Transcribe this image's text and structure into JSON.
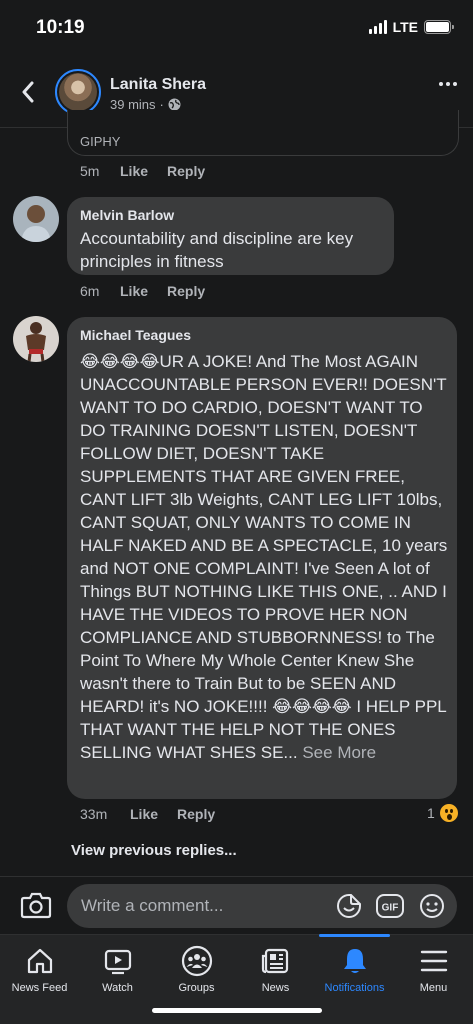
{
  "status": {
    "time": "10:19",
    "network": "LTE"
  },
  "header": {
    "name": "Lanita Shera",
    "time": "39 mins",
    "separator": "·"
  },
  "giphy_comment": {
    "label": "GIPHY",
    "time": "5m",
    "like": "Like",
    "reply": "Reply"
  },
  "comments": [
    {
      "author": "Melvin Barlow",
      "text": "Accountability and discipline are key principles in fitness",
      "time": "6m",
      "like": "Like",
      "reply": "Reply"
    },
    {
      "author": "Michael Teagues",
      "text": "😂😂😂😂UR A JOKE! And The Most AGAIN UNACCOUNTABLE PERSON EVER!! DOESN'T WANT TO DO CARDIO, DOESN'T WANT TO DO TRAINING DOESN'T LISTEN, DOESN'T FOLLOW DIET, DOESN'T TAKE SUPPLEMENTS THAT ARE GIVEN FREE, CANT LIFT 3lb Weights, CANT LEG LIFT 10lbs, CANT SQUAT, ONLY WANTS TO COME IN HALF NAKED AND BE A SPECTACLE, 10 years and NOT ONE COMPLAINT! I've Seen A lot of Things BUT NOTHING LIKE THIS ONE, .. AND I HAVE THE VIDEOS TO PROVE HER NON COMPLIANCE AND STUBBORNNESS! to The Point To Where My Whole Center Knew She wasn't there to Train But to be SEEN AND HEARD! it's NO JOKE!!!! 😂😂😂😂 I HELP PPL THAT WANT THE HELP NOT THE ONES SELLING WHAT SHES SE...",
      "see_more": "See More",
      "time": "33m",
      "like": "Like",
      "reply": "Reply",
      "reaction_count": "1"
    }
  ],
  "view_previous": "View previous replies...",
  "composer": {
    "placeholder": "Write a comment..."
  },
  "tabs": [
    {
      "label": "News Feed",
      "icon": "home-icon"
    },
    {
      "label": "Watch",
      "icon": "watch-icon"
    },
    {
      "label": "Groups",
      "icon": "groups-icon"
    },
    {
      "label": "News",
      "icon": "news-icon"
    },
    {
      "label": "Notifications",
      "icon": "bell-icon",
      "active": true
    },
    {
      "label": "Menu",
      "icon": "menu-icon"
    }
  ],
  "colors": {
    "accent": "#2d88ff",
    "background": "#18191a",
    "bubble": "#3a3b3c"
  }
}
